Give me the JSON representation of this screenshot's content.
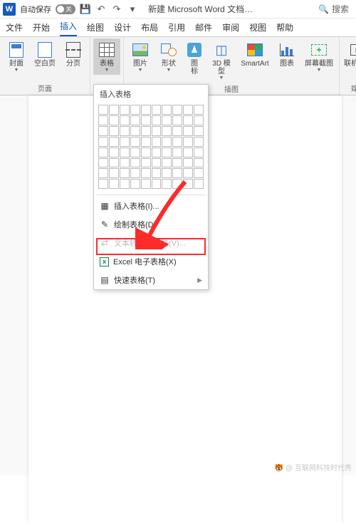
{
  "titlebar": {
    "app_badge": "W",
    "autosave_label": "自动保存",
    "autosave_state": "关",
    "doc_title": "新建 Microsoft Word 文档…",
    "search_placeholder": "搜索"
  },
  "tabs": [
    "文件",
    "开始",
    "插入",
    "绘图",
    "设计",
    "布局",
    "引用",
    "邮件",
    "审阅",
    "视图",
    "帮助"
  ],
  "active_tab_index": 2,
  "ribbon": {
    "groups": [
      {
        "label": "页面",
        "items": [
          {
            "name": "cover-page",
            "label": "封面",
            "caret": true
          },
          {
            "name": "blank-page",
            "label": "空白页"
          },
          {
            "name": "page-break",
            "label": "分页"
          }
        ]
      },
      {
        "label": "表格",
        "items": [
          {
            "name": "table",
            "label": "表格",
            "caret": true,
            "active": true
          }
        ]
      },
      {
        "label": "插图",
        "items": [
          {
            "name": "pictures",
            "label": "图片",
            "caret": true
          },
          {
            "name": "shapes",
            "label": "形状",
            "caret": true
          },
          {
            "name": "icons",
            "label": "图\n标"
          },
          {
            "name": "3d-models",
            "label": "3D 模\n型",
            "caret": true
          },
          {
            "name": "smartart",
            "label": "SmartArt"
          },
          {
            "name": "chart",
            "label": "图表"
          },
          {
            "name": "screenshot",
            "label": "屏幕截图",
            "caret": true
          }
        ]
      },
      {
        "label": "媒体",
        "items": [
          {
            "name": "online-video",
            "label": "联机视…"
          }
        ]
      }
    ]
  },
  "dropdown": {
    "title": "插入表格",
    "grid_cols": 10,
    "grid_rows": 8,
    "items": [
      {
        "id": "insert-table",
        "icon": "▦",
        "label": "插入表格(I)..."
      },
      {
        "id": "draw-table",
        "icon": "✎",
        "label": "绘制表格(D)"
      },
      {
        "id": "text-to-table",
        "icon": "⇄",
        "label": "文本转换成表格(V)...",
        "disabled": true
      },
      {
        "id": "excel-spreadsheet",
        "icon": "x",
        "label": "Excel 电子表格(X)",
        "highlighted": true
      },
      {
        "id": "quick-tables",
        "icon": "▤",
        "label": "快速表格(T)",
        "submenu": true
      }
    ]
  },
  "watermark": "🐯 @ 互联网科技时代秀"
}
